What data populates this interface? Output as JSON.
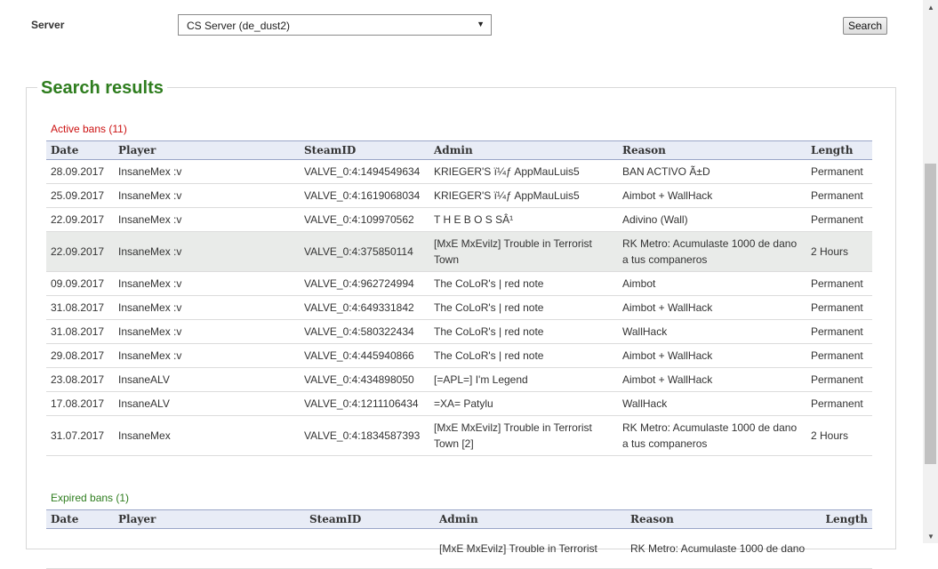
{
  "filter": {
    "server_label": "Server",
    "server_value": "CS Server (de_dust2)",
    "search_label": "Search"
  },
  "results": {
    "title": "Search results",
    "active_title": "Active bans (11)",
    "expired_title": "Expired bans (1)",
    "columns": [
      "Date",
      "Player",
      "SteamID",
      "Admin",
      "Reason",
      "Length"
    ],
    "active_rows": [
      {
        "date": "28.09.2017",
        "player": "InsaneMex :v",
        "steamid": "VALVE_0:4:1494549634",
        "admin": "KRIEGER'S ï¼ƒ AppMauLuis5",
        "reason": "BAN ACTIVO Ã±D",
        "length": "Permanent"
      },
      {
        "date": "25.09.2017",
        "player": "InsaneMex :v",
        "steamid": "VALVE_0:4:1619068034",
        "admin": "KRIEGER'S ï¼ƒ AppMauLuis5",
        "reason": "Aimbot + WallHack",
        "length": "Permanent"
      },
      {
        "date": "22.09.2017",
        "player": "InsaneMex :v",
        "steamid": "VALVE_0:4:109970562",
        "admin": "T H E B O S SÂ¹",
        "reason": "Adivino (Wall)",
        "length": "Permanent"
      },
      {
        "date": "22.09.2017",
        "player": "InsaneMex :v",
        "steamid": "VALVE_0:4:375850114",
        "admin": "[MxE MxEvilz] Trouble in Terrorist Town",
        "reason": "RK Metro: Acumulaste 1000 de dano a tus companeros",
        "length": "2 Hours"
      },
      {
        "date": "09.09.2017",
        "player": "InsaneMex :v",
        "steamid": "VALVE_0:4:962724994",
        "admin": "The CoLoR's | red note",
        "reason": "Aimbot",
        "length": "Permanent"
      },
      {
        "date": "31.08.2017",
        "player": "InsaneMex :v",
        "steamid": "VALVE_0:4:649331842",
        "admin": "The CoLoR's | red note",
        "reason": "Aimbot + WallHack",
        "length": "Permanent"
      },
      {
        "date": "31.08.2017",
        "player": "InsaneMex :v",
        "steamid": "VALVE_0:4:580322434",
        "admin": "The CoLoR's | red note",
        "reason": "WallHack",
        "length": "Permanent"
      },
      {
        "date": "29.08.2017",
        "player": "InsaneMex :v",
        "steamid": "VALVE_0:4:445940866",
        "admin": "The CoLoR's | red note",
        "reason": "Aimbot + WallHack",
        "length": "Permanent"
      },
      {
        "date": "23.08.2017",
        "player": "InsaneALV",
        "steamid": "VALVE_0:4:434898050",
        "admin": "[=APL=] I'm Legend",
        "reason": "Aimbot + WallHack",
        "length": "Permanent"
      },
      {
        "date": "17.08.2017",
        "player": "InsaneALV",
        "steamid": "VALVE_0:4:1211106434",
        "admin": "=XA= Patylu",
        "reason": "WallHack",
        "length": "Permanent"
      },
      {
        "date": "31.07.2017",
        "player": "InsaneMex",
        "steamid": "VALVE_0:4:1834587393",
        "admin": "[MxE MxEvilz] Trouble in Terrorist Town [2]",
        "reason": "RK Metro: Acumulaste 1000 de dano a tus companeros",
        "length": "2 Hours"
      }
    ],
    "expired_rows": [
      {
        "date": "",
        "player": "",
        "steamid": "",
        "admin": "[MxE MxEvilz] Trouble in Terrorist",
        "reason": "RK Metro: Acumulaste 1000 de dano",
        "length": ""
      }
    ]
  },
  "colors": {
    "accent_green": "#2e7d1e",
    "active_red": "#cc1111",
    "header_bg": "#e8ecf6"
  }
}
